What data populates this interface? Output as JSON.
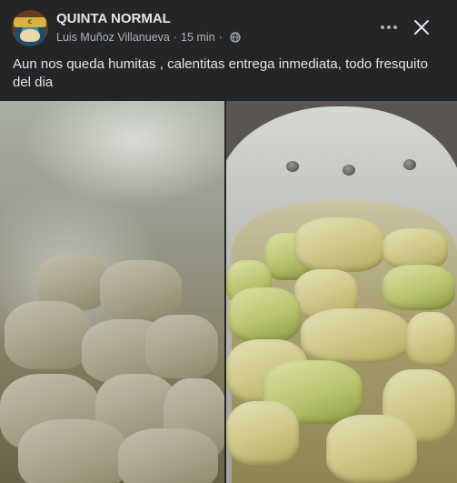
{
  "post": {
    "group_name": "QUINTA NORMAL",
    "author": "Luis Muñoz Villanueva",
    "separator": "·",
    "time": "15 min",
    "privacy_icon": "globe-icon",
    "text": "Aun nos queda humitas , calentitas entrega inmediata, todo fresquito del dia",
    "avatar_badge_text": "C"
  },
  "actions": {
    "more_icon": "more-horizontal-icon",
    "close_icon": "close-icon"
  },
  "colors": {
    "background": "#242526",
    "text_primary": "#e4e6eb",
    "text_secondary": "#b0b3b8"
  },
  "photos": [
    {
      "name": "humitas-steaming-photo"
    },
    {
      "name": "humitas-pot-photo"
    }
  ]
}
